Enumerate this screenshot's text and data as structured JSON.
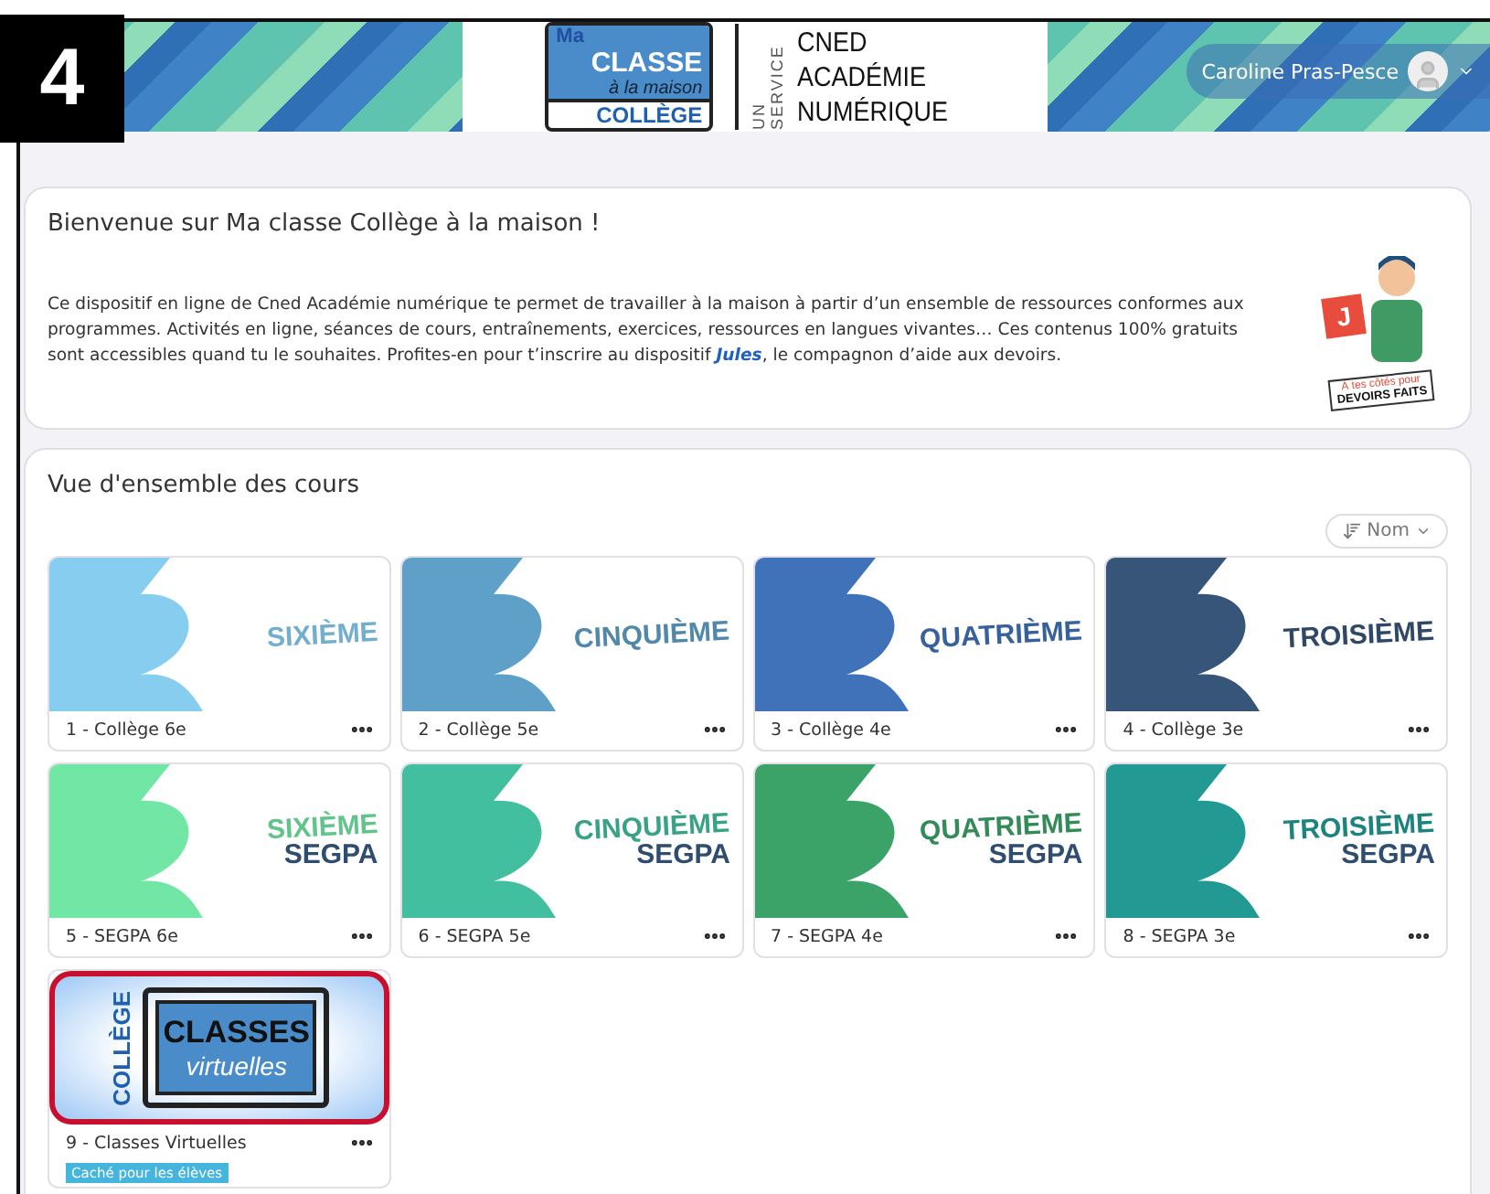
{
  "annotation": {
    "step": "4"
  },
  "header": {
    "logo": {
      "top": "Ma",
      "main": "CLASSE",
      "sub": "à la maison",
      "bottom": "COLLÈGE"
    },
    "service": {
      "vertical": "UN SERVICE",
      "lines": [
        "CNED",
        "ACADÉMIE",
        "NUMÉRIQUE"
      ]
    },
    "user": {
      "name": "Caroline Pras-Pesce"
    }
  },
  "welcome": {
    "title": "Bienvenue sur Ma classe Collège à la maison !",
    "text_before": "Ce dispositif en ligne de Cned Académie numérique te permet de travailler à la maison à partir d’un ensemble de ressources conformes aux programmes. Activités en ligne, séances de cours, entraînements, exercices, ressources en langues vivantes… Ces contenus 100% gratuits sont accessibles quand tu le souhaites. Profites-en pour t’inscrire au dispositif ",
    "link": "Jules",
    "text_after": ", le compagnon d’aide aux devoirs.",
    "illustration": {
      "letter": "J",
      "caption": "À tes côtés pour",
      "caption_bold": "DEVOIRS FAITS"
    }
  },
  "courses": {
    "title": "Vue d'ensemble des cours",
    "sort": {
      "label": "Nom"
    },
    "items": [
      {
        "kind": "level",
        "name": "1 - Collège 6e",
        "image_title": "SIXIÈME",
        "color": "#87cdf0"
      },
      {
        "kind": "level",
        "name": "2 - Collège 5e",
        "image_title": "CINQUIÈME",
        "color": "#5fa0c8"
      },
      {
        "kind": "level",
        "name": "3 - Collège 4e",
        "image_title": "QUATRIÈME",
        "color": "#3f72b8"
      },
      {
        "kind": "level",
        "name": "4 - Collège 3e",
        "image_title": "TROISIÈME",
        "color": "#365578"
      },
      {
        "kind": "level",
        "name": "5 - SEGPA 6e",
        "image_title": "SIXIÈME",
        "image_subtitle": "SEGPA",
        "color": "#72e6a4"
      },
      {
        "kind": "level",
        "name": "6 - SEGPA 5e",
        "image_title": "CINQUIÈME",
        "image_subtitle": "SEGPA",
        "color": "#42bf9e"
      },
      {
        "kind": "level",
        "name": "7 - SEGPA 4e",
        "image_title": "QUATRIÈME",
        "image_subtitle": "SEGPA",
        "color": "#3ba367"
      },
      {
        "kind": "level",
        "name": "8 - SEGPA 3e",
        "image_title": "TROISIÈME",
        "image_subtitle": "SEGPA",
        "color": "#229a93"
      },
      {
        "kind": "virtual",
        "name": "9 - Classes Virtuelles",
        "image_side": "COLLÈGE",
        "image_title": "CLASSES",
        "image_script": "virtuelles",
        "badge": "Caché pour les élèves",
        "highlighted": true
      }
    ]
  }
}
